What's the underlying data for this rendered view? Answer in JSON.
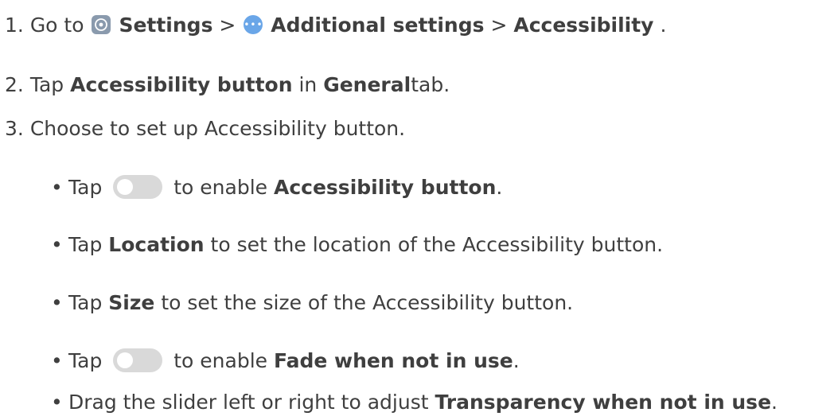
{
  "steps": [
    {
      "num": "1.",
      "go_to": "Go to",
      "settings": "Settings",
      "sep1": ">",
      "additional": "Additional settings",
      "sep2": ">",
      "accessibility": "Accessibility",
      "end": "."
    },
    {
      "num": "2.",
      "tap": "Tap",
      "button": "Accessibility button",
      "in": "in",
      "general": "General",
      "tab": "tab."
    },
    {
      "num": "3.",
      "text": "Choose to set up Accessibility button."
    }
  ],
  "bullets": [
    {
      "mark": "•",
      "tap": "Tap",
      "rest": "to enable",
      "bold": "Accessibility button",
      "end": "."
    },
    {
      "mark": "•",
      "tap": "Tap",
      "bold": "Location",
      "rest": "to set the location of the Accessibility button."
    },
    {
      "mark": "•",
      "tap": "Tap",
      "bold": "Size",
      "rest": "to set the size of the Accessibility button."
    },
    {
      "mark": "•",
      "tap": "Tap",
      "rest": "to enable",
      "bold": "Fade when not in use",
      "end": "."
    },
    {
      "mark": "•",
      "text": "Drag the slider left or right to adjust",
      "bold": "Transparency when not in use",
      "end": "."
    }
  ],
  "icons": {
    "settings_icon": "settings-icon",
    "more_icon": "more-icon",
    "toggle_icon": "toggle-off-icon"
  },
  "colors": {
    "text": "#3f3f3f",
    "settings_icon_bg": "#8a9aad",
    "more_icon_bg": "#6aa6e8",
    "toggle_bg": "#d9d9d9"
  }
}
